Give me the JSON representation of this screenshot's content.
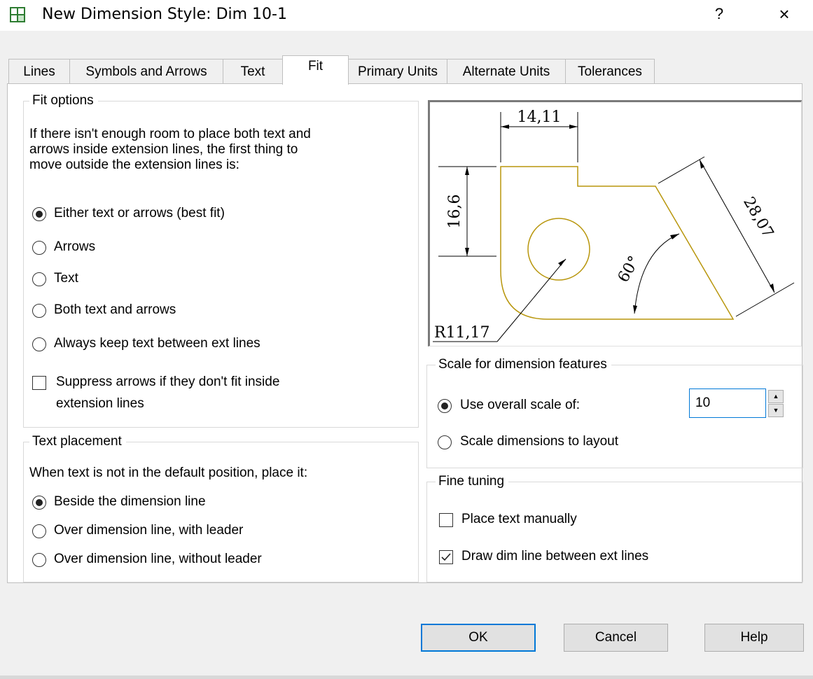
{
  "window": {
    "title": "New Dimension Style: Dim 10-1",
    "help_label": "?",
    "close_label": "×"
  },
  "tabs": [
    {
      "label": "Lines"
    },
    {
      "label": "Symbols and Arrows"
    },
    {
      "label": "Text"
    },
    {
      "label": "Fit",
      "active": true
    },
    {
      "label": "Primary Units"
    },
    {
      "label": "Alternate Units"
    },
    {
      "label": "Tolerances"
    }
  ],
  "fit_options": {
    "legend": "Fit options",
    "description": [
      "If there isn't enough room to place both text and",
      "arrows inside extension lines, the first thing to",
      "move outside the extension lines is:"
    ],
    "options": [
      {
        "label": "Either text or arrows (best fit)",
        "selected": true
      },
      {
        "label": "Arrows",
        "selected": false
      },
      {
        "label": "Text",
        "selected": false
      },
      {
        "label": "Both text and arrows",
        "selected": false
      },
      {
        "label": "Always keep text between ext lines",
        "selected": false
      }
    ],
    "suppress": {
      "label_line1": "Suppress arrows if they don't fit inside",
      "label_line2": "extension lines",
      "checked": false
    }
  },
  "text_placement": {
    "legend": "Text placement",
    "description": "When text is not in the default position, place it:",
    "options": [
      {
        "label": "Beside the dimension line",
        "selected": true
      },
      {
        "label": "Over dimension line, with leader",
        "selected": false
      },
      {
        "label": "Over dimension line, without leader",
        "selected": false
      }
    ]
  },
  "preview": {
    "dim_top": "14,11",
    "dim_left": "16,6",
    "dim_diagonal": "28,07",
    "dim_angle": "60°",
    "dim_radius": "R11,17",
    "colors": {
      "outline": "#b8960c",
      "dims": "#000000"
    }
  },
  "scale": {
    "legend": "Scale for dimension features",
    "use_overall_label": "Use overall scale of:",
    "use_overall_selected": true,
    "scale_value": "10",
    "layout_label": "Scale dimensions to layout",
    "layout_selected": false
  },
  "fine_tuning": {
    "legend": "Fine tuning",
    "place_manual_label": "Place text manually",
    "place_manual_checked": false,
    "draw_dim_label": "Draw dim line between ext lines",
    "draw_dim_checked": true
  },
  "buttons": {
    "ok": "OK",
    "cancel": "Cancel",
    "help": "Help"
  },
  "accent_color": "#0078d7"
}
